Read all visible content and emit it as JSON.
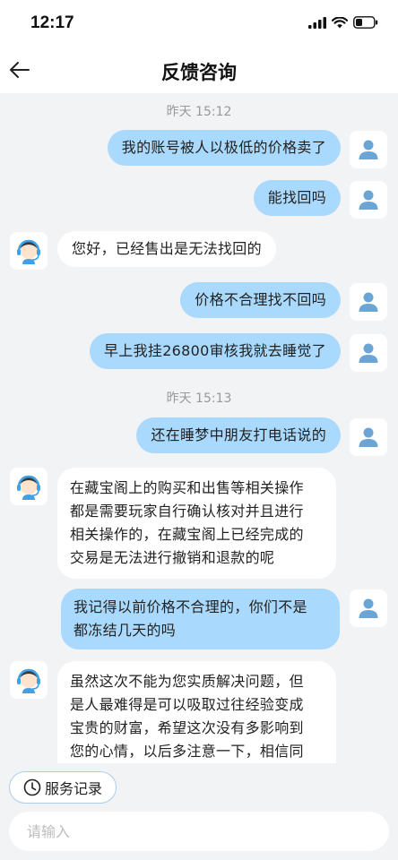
{
  "status": {
    "time": "12:17"
  },
  "nav": {
    "title": "反馈咨询"
  },
  "timestamps": [
    "昨天 15:12",
    "昨天 15:13"
  ],
  "messages": [
    {
      "from": "user",
      "text": "我的账号被人以极低的价格卖了"
    },
    {
      "from": "user",
      "text": "能找回吗"
    },
    {
      "from": "agent",
      "text": "您好，已经售出是无法找回的"
    },
    {
      "from": "user",
      "text": "价格不合理找不回吗"
    },
    {
      "from": "user",
      "text": "早上我挂26800审核我就去睡觉了"
    },
    {
      "from": "user",
      "text": "还在睡梦中朋友打电话说的"
    },
    {
      "from": "agent",
      "lines": [
        "在藏宝阁上的购买和出售等相关操作",
        "都是需要玩家自行确认核对并且进行",
        "相关操作的，在藏宝阁上已经完成的",
        "交易是无法进行撤销和退款的呢"
      ]
    },
    {
      "from": "user",
      "lines": [
        "我记得以前价格不合理的，你们不是",
        "都冻结几天的吗"
      ]
    },
    {
      "from": "agent",
      "lines": [
        "虽然这次不能为您实质解决问题，但",
        "是人最难得是可以吸取过往经验变成",
        "宝贵的财富，希望这次没有多影响到",
        "您的心情，以后多注意一下，相信同"
      ]
    }
  ],
  "bottom": {
    "service_label": "服务记录",
    "input_placeholder": "请输入"
  },
  "colors": {
    "user_bubble": "#a9d9fc",
    "agent_bubble": "#ffffff",
    "background": "#f2f3f5"
  }
}
